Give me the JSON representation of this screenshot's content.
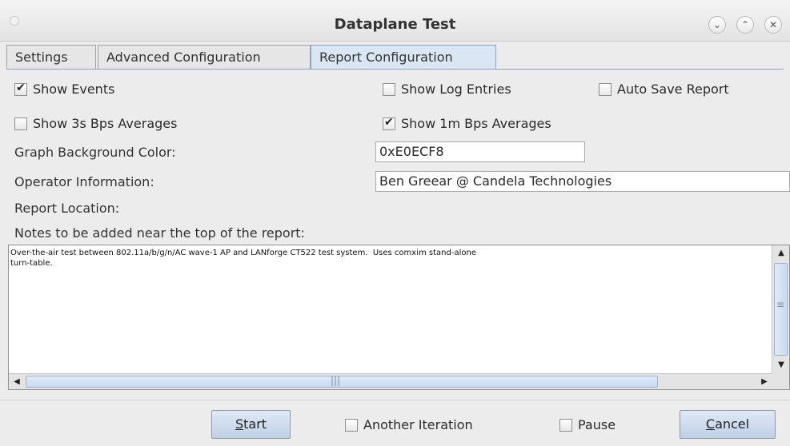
{
  "window": {
    "title": "Dataplane Test"
  },
  "tabs": [
    {
      "label": "Settings"
    },
    {
      "label": "Advanced Configuration"
    },
    {
      "label": "Report Configuration",
      "active": true
    }
  ],
  "report": {
    "show_events": {
      "label": "Show Events",
      "checked": true
    },
    "show_log_entries": {
      "label": "Show Log Entries",
      "checked": false
    },
    "auto_save_report": {
      "label": "Auto Save Report",
      "checked": false
    },
    "show_3s_bps": {
      "label": "Show 3s Bps Averages",
      "checked": false
    },
    "show_1m_bps": {
      "label": "Show 1m Bps Averages",
      "checked": true
    },
    "graph_bg_label": "Graph Background Color:",
    "graph_bg_value": "0xE0ECF8",
    "operator_label": "Operator Information:",
    "operator_value": "Ben Greear @ Candela Technologies",
    "report_location_label": "Report Location:",
    "notes_label": "Notes to be added near the top of the report:",
    "notes_value": "Over-the-air test between 802.11a/b/g/n/AC wave-1 AP and LANforge CT522 test system.  Uses comxim stand-alone\nturn-table."
  },
  "footer": {
    "start_prefix": "",
    "start_mnemonic": "S",
    "start_rest": "tart",
    "another_iteration": {
      "label": "Another Iteration",
      "checked": false
    },
    "pause": {
      "label": "Pause",
      "checked": false
    },
    "cancel_mnemonic": "C",
    "cancel_rest": "ancel"
  },
  "colors": {
    "accent": "#dbe6f4",
    "graph_bg": "#E0ECF8"
  }
}
